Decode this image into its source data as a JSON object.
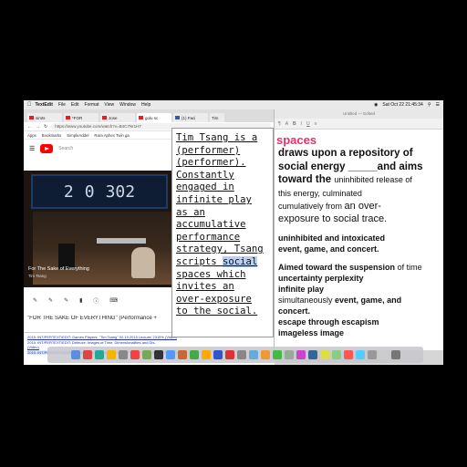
{
  "menubar": {
    "apple": "",
    "app": "TextEdit",
    "items": [
      "File",
      "Edit",
      "Format",
      "View",
      "Window",
      "Help"
    ],
    "clock": "Sat Oct 22  21:45:34"
  },
  "browser": {
    "tabs": [
      "simts",
      "*FOR",
      "Jose",
      "golu sc",
      "(1) Faci",
      "Tim"
    ],
    "url": "https://www.youtube.com/watch?v=B4C7Nr1H7",
    "bookmarks": [
      "Apps",
      "Bookmarks",
      "SimpleAddel",
      "Rara Aphex Twin ga"
    ],
    "search_placeholder": "Search",
    "video": {
      "scoreboard": [
        "2",
        "0",
        "302"
      ],
      "caption": "For The Sake of Everything",
      "sub": "Tim Tsang"
    },
    "video_title": "\"FOR THE SAKE OF EVERYTHING\" (Performance + ",
    "links": [
      "2015: INT/PERTEXT/EDIT: Games Players: \"Tim Tsang\" 02.19.2015 Lecture/ 2315% (Video)",
      "2015: INT/PERTEXT/EDIT: Deleuze: Images of Time, Dimensionalities and Dis-",
      "(Video)",
      "2015: INT/PERTEXT/EDIT: Tim Jennings: \"Women Computers\" 02.9.2015 Lecture/ 2315% (Video)"
    ]
  },
  "textedit": {
    "title": "Untitled — Edited",
    "heading": "spaces",
    "lines": [
      "draws upon a repository of",
      "social energy _____and aims",
      "toward the"
    ],
    "inline_small_1": "uninhibited release of",
    "small_2": "this energy, culminated",
    "line_cum_a": "cumulatively from",
    "line_cum_b": "an over-",
    "line_exp": "exposure to social trace.",
    "block1": [
      "uninhibited and intoxicated",
      "event, game, and concert."
    ],
    "block2_a": "Aimed toward the",
    "block2_b": "suspension",
    "block2_c": "of time",
    "block2": [
      "uncertainty perplexity",
      "infinite play"
    ],
    "block3_a": "simultaneously",
    "block3_b": "event, game, and",
    "block3": [
      "concert.",
      "escape through escapism",
      "imageless image"
    ]
  },
  "popup": {
    "lines": [
      "Tim Tsang is a",
      "(performer)",
      "(performer).",
      "Constantly",
      "engaged in",
      "infinite play",
      "as an",
      "accumulative",
      "performance",
      "strategy, Tsang",
      "scripts ",
      "spaces which",
      "invites an",
      "over-exposure",
      "to the social."
    ],
    "highlight": "social"
  },
  "dock_colors": [
    "#5a8fe0",
    "#d44",
    "#2a9",
    "#f4b400",
    "#888",
    "#e44",
    "#7a5",
    "#333",
    "#59f",
    "#c63",
    "#4a4",
    "#fa0",
    "#35c",
    "#d33",
    "#888",
    "#6ad",
    "#e93",
    "#4b4",
    "#9a9",
    "#c4c",
    "#369",
    "#dd4",
    "#8c8",
    "#f55",
    "#5cf",
    "#999",
    "#ccc",
    "#777"
  ]
}
